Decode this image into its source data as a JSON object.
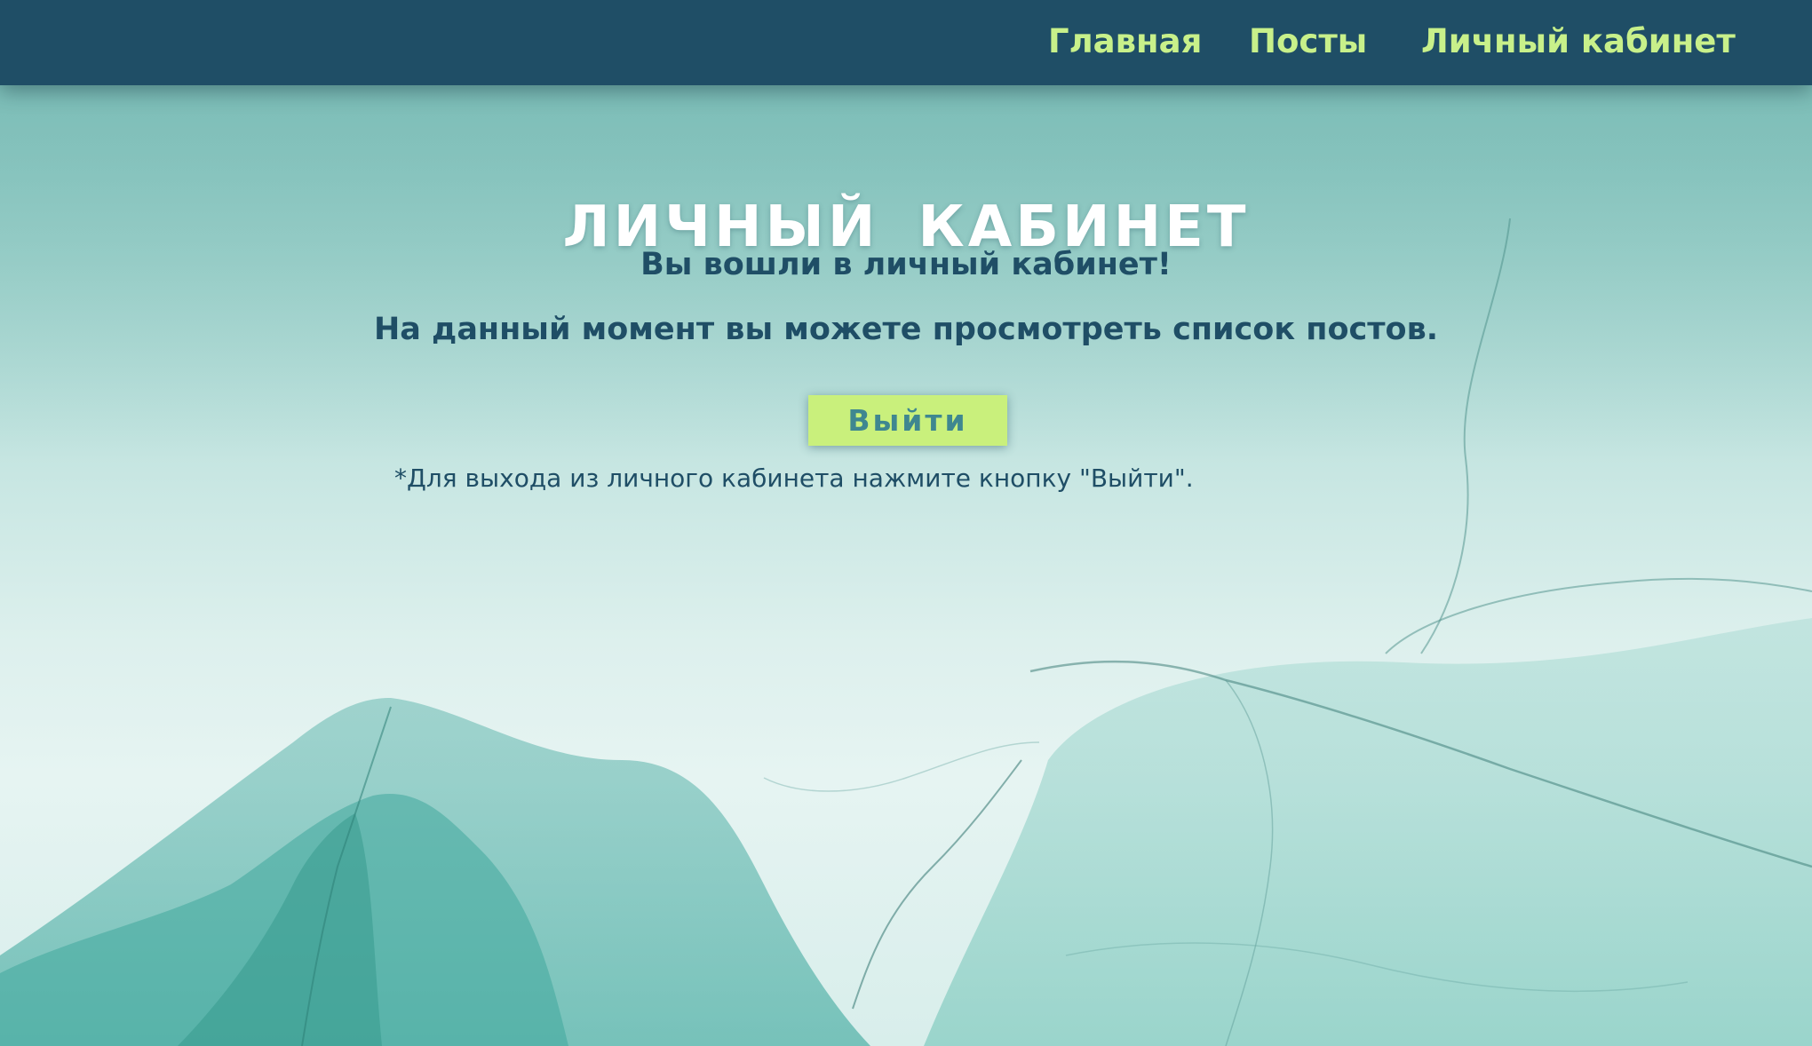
{
  "nav": {
    "home_label": "Главная",
    "posts_label": "Посты",
    "cabinet_label": "Личный кабинет"
  },
  "page": {
    "title_word1": "ЛИЧНЫЙ",
    "title_word2": "КАБИНЕТ",
    "welcome_text": "Вы вошли в личный кабинет!",
    "info_text": "На данный момент вы можете просмотреть список постов.",
    "logout_label": "Выйти",
    "note_text": "*Для выхода из личного кабинета нажмите кнопку \"Выйти\"."
  },
  "colors": {
    "navbar": "#1f4e66",
    "nav_text": "#c8f08a",
    "button": "#c9f07c",
    "button_text": "#3f8790",
    "body_text": "#1f4e66",
    "title_text": "#ffffff"
  }
}
